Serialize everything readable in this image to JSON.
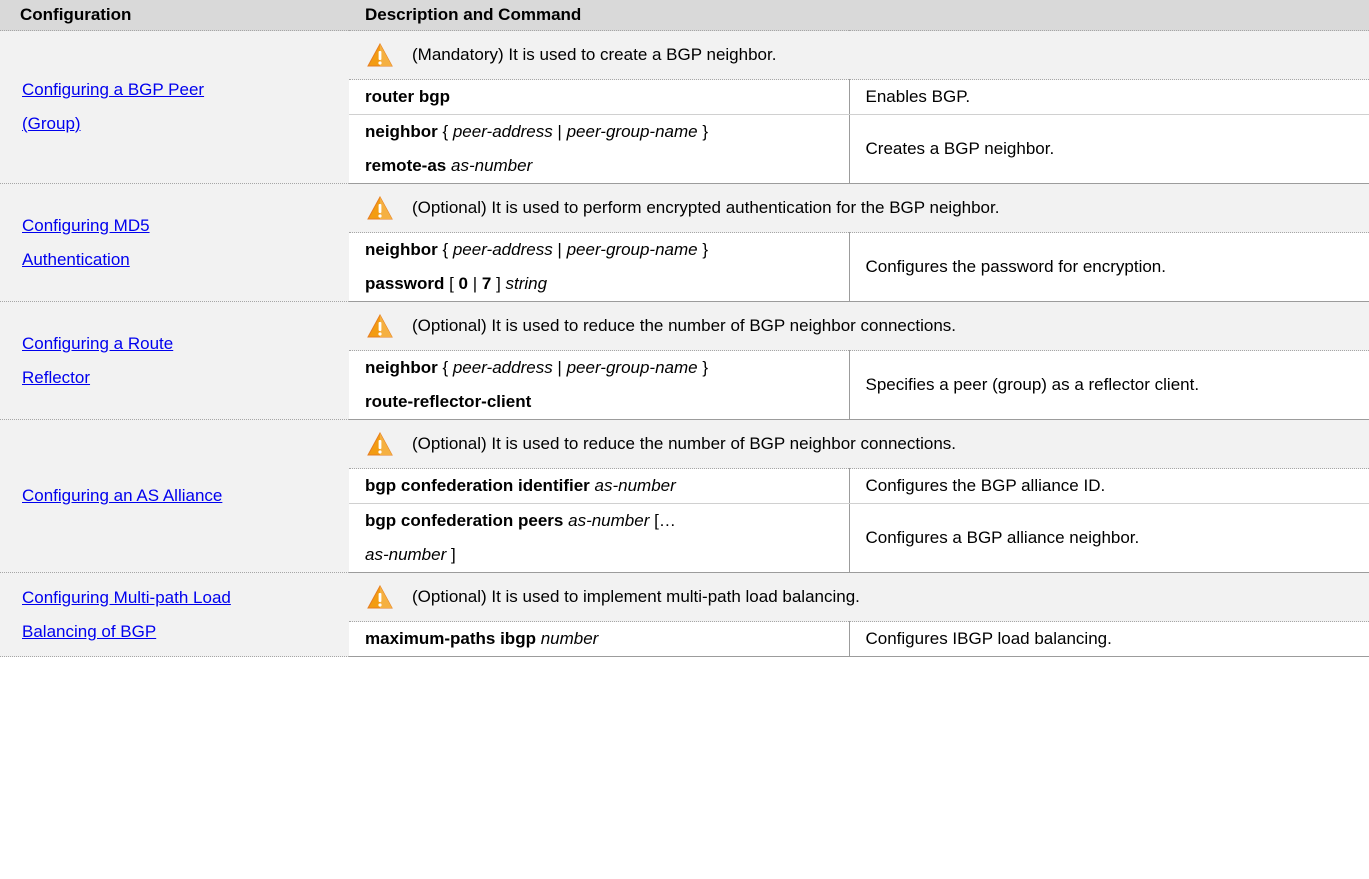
{
  "header": {
    "configuration": "Configuration",
    "description": "Description and Command"
  },
  "sections": [
    {
      "link": [
        "Configuring a BGP Peer",
        "(Group)"
      ],
      "note": "(Mandatory) It is used to create a BGP neighbor.",
      "rows": [
        {
          "cmd": [
            [
              {
                "t": "router bgp",
                "b": true
              }
            ]
          ],
          "desc": "Enables BGP."
        },
        {
          "cmd": [
            [
              {
                "t": "neighbor",
                "b": true
              },
              {
                "t": " { "
              },
              {
                "t": "peer-address",
                "i": true
              },
              {
                "t": " | "
              },
              {
                "t": "peer-group-name",
                "i": true
              },
              {
                "t": " }"
              }
            ],
            [
              {
                "t": "remote-as",
                "b": true
              },
              {
                "t": " "
              },
              {
                "t": "as-number",
                "i": true
              }
            ]
          ],
          "desc": "Creates a BGP neighbor."
        }
      ]
    },
    {
      "link": [
        "Configuring MD5",
        "Authentication"
      ],
      "note": "(Optional) It is used to perform encrypted authentication for the BGP neighbor.",
      "rows": [
        {
          "cmd": [
            [
              {
                "t": "neighbor",
                "b": true
              },
              {
                "t": " { "
              },
              {
                "t": "peer-address",
                "i": true
              },
              {
                "t": " | "
              },
              {
                "t": "peer-group-name",
                "i": true
              },
              {
                "t": " }"
              }
            ],
            [
              {
                "t": "password",
                "b": true
              },
              {
                "t": " [ "
              },
              {
                "t": "0",
                "b": true
              },
              {
                "t": " | "
              },
              {
                "t": "7",
                "b": true
              },
              {
                "t": " ] "
              },
              {
                "t": "string",
                "i": true
              }
            ]
          ],
          "desc": "Configures the password for encryption."
        }
      ]
    },
    {
      "link": [
        "Configuring a Route",
        "Reflector"
      ],
      "note": "(Optional) It is used to reduce the number of BGP neighbor connections.",
      "rows": [
        {
          "cmd": [
            [
              {
                "t": "neighbor",
                "b": true
              },
              {
                "t": " { "
              },
              {
                "t": "peer-address",
                "i": true
              },
              {
                "t": " | "
              },
              {
                "t": "peer-group-name",
                "i": true
              },
              {
                "t": " }"
              }
            ],
            [
              {
                "t": "route-reflector-client",
                "b": true
              }
            ]
          ],
          "desc": "Specifies a peer (group) as a reflector client."
        }
      ]
    },
    {
      "link": [
        "Configuring an AS Alliance"
      ],
      "note": "(Optional) It is used to reduce the number of BGP neighbor connections.",
      "rows": [
        {
          "cmd": [
            [
              {
                "t": "bgp confederation identifier",
                "b": true
              },
              {
                "t": " "
              },
              {
                "t": "as-number",
                "i": true
              }
            ]
          ],
          "desc": "Configures the BGP alliance ID."
        },
        {
          "cmd": [
            [
              {
                "t": "bgp confederation peers",
                "b": true
              },
              {
                "t": " "
              },
              {
                "t": "as-number",
                "i": true
              },
              {
                "t": " […"
              }
            ],
            [
              {
                "t": "as-number",
                "i": true
              },
              {
                "t": " ]"
              }
            ]
          ],
          "desc": "Configures a BGP alliance neighbor."
        }
      ]
    },
    {
      "link": [
        "Configuring Multi-path Load",
        "Balancing of BGP"
      ],
      "note": "(Optional) It is used to implement multi-path load balancing.",
      "rows": [
        {
          "cmd": [
            [
              {
                "t": "maximum-paths ibgp",
                "b": true
              },
              {
                "t": " "
              },
              {
                "t": "number",
                "i": true
              }
            ]
          ],
          "desc": "Configures IBGP load balancing."
        }
      ]
    }
  ],
  "icon": "warning-icon",
  "colors": {
    "link": "#0000ee",
    "header_bg": "#d9d9d9",
    "note_bg": "#f2f2f2",
    "warning": "#f39c12"
  }
}
